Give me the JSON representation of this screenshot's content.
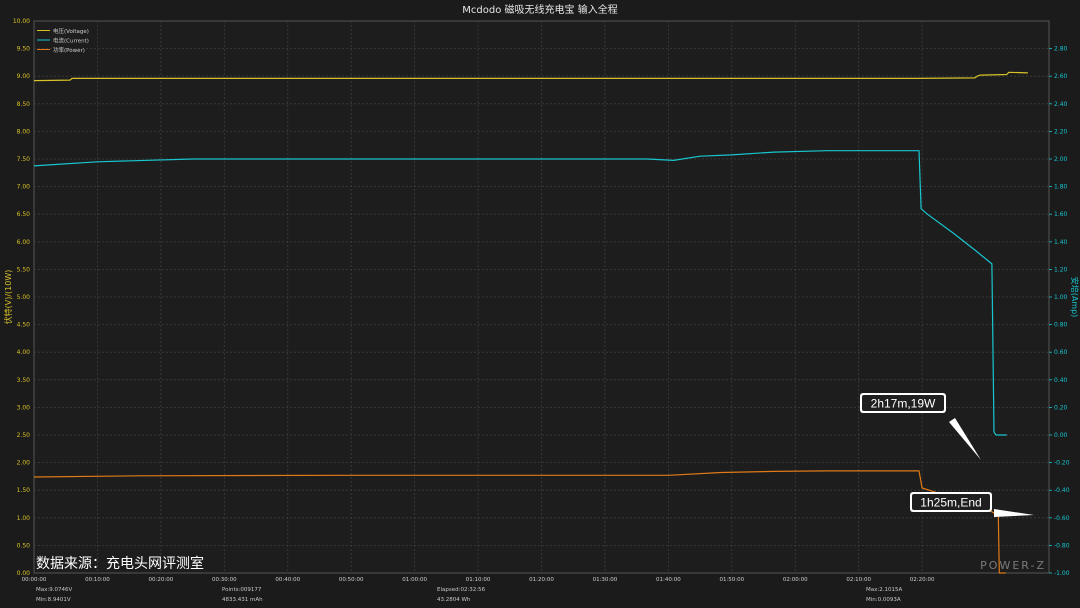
{
  "chart_data": {
    "type": "line",
    "title": "Mcdodo 磁吸无线充电宝 输入全程",
    "ylabel_left": "伏特(V)/(10W)",
    "ylabel_right": "安培(Amp)",
    "ylim_left": [
      0,
      10
    ],
    "ylim_right": [
      -1,
      3
    ],
    "x_unit": "seconds",
    "xlim": [
      0,
      9600
    ],
    "left_ticks": [
      "0.00",
      "0.50",
      "1.00",
      "1.50",
      "2.00",
      "2.50",
      "3.00",
      "3.50",
      "4.00",
      "4.50",
      "5.00",
      "5.50",
      "6.00",
      "6.50",
      "7.00",
      "7.50",
      "8.00",
      "8.50",
      "9.00",
      "9.50",
      "10.00"
    ],
    "right_ticks": [
      "-1.00",
      "-0.80",
      "-0.60",
      "-0.40",
      "-0.20",
      "0.00",
      "0.20",
      "0.40",
      "0.60",
      "0.80",
      "1.00",
      "1.20",
      "1.40",
      "1.60",
      "1.80",
      "2.00",
      "2.20",
      "2.40",
      "2.60",
      "2.80"
    ],
    "x_ticks": [
      "00:00:00",
      "00:10:00",
      "00:20:00",
      "00:30:00",
      "00:40:00",
      "00:50:00",
      "01:00:00",
      "01:10:00",
      "01:20:00",
      "01:30:00",
      "01:40:00",
      "01:50:00",
      "02:00:00",
      "02:10:00",
      "02:20:00"
    ],
    "legend": [
      {
        "name": "电压(Voltage)",
        "color": "#d8c228"
      },
      {
        "name": "电流(Current)",
        "color": "#18c6cf"
      },
      {
        "name": "功率(Power)",
        "color": "#e07a18"
      }
    ],
    "series": [
      {
        "name": "电压(Voltage)",
        "axis": "left",
        "color": "#d8c228",
        "points": [
          [
            0,
            8.92
          ],
          [
            340,
            8.93
          ],
          [
            360,
            8.96
          ],
          [
            8350,
            8.96
          ],
          [
            8900,
            8.97
          ],
          [
            8920,
            9.0
          ],
          [
            8950,
            9.02
          ],
          [
            9200,
            9.03
          ],
          [
            9220,
            9.07
          ],
          [
            9400,
            9.06
          ]
        ]
      },
      {
        "name": "电流(Current)",
        "axis": "right",
        "color": "#18c6cf",
        "points": [
          [
            0,
            1.95
          ],
          [
            200,
            1.96
          ],
          [
            600,
            1.98
          ],
          [
            1500,
            2.0
          ],
          [
            3000,
            2.0
          ],
          [
            5800,
            2.0
          ],
          [
            6050,
            1.99
          ],
          [
            6300,
            2.02
          ],
          [
            6600,
            2.03
          ],
          [
            7000,
            2.05
          ],
          [
            7500,
            2.06
          ],
          [
            8100,
            2.06
          ],
          [
            8370,
            2.06
          ],
          [
            8390,
            1.64
          ],
          [
            8450,
            1.6
          ],
          [
            8700,
            1.46
          ],
          [
            8900,
            1.34
          ],
          [
            9060,
            1.24
          ],
          [
            9080,
            0.02
          ],
          [
            9100,
            0.0
          ],
          [
            9200,
            0.0
          ]
        ]
      },
      {
        "name": "功率(Power)",
        "axis": "left",
        "color": "#e07a18",
        "points": [
          [
            0,
            1.74
          ],
          [
            1000,
            1.76
          ],
          [
            3000,
            1.77
          ],
          [
            6000,
            1.77
          ],
          [
            6500,
            1.82
          ],
          [
            7000,
            1.84
          ],
          [
            7500,
            1.85
          ],
          [
            8100,
            1.85
          ],
          [
            8370,
            1.85
          ],
          [
            8400,
            1.54
          ],
          [
            8500,
            1.48
          ],
          [
            8700,
            1.36
          ],
          [
            8900,
            1.22
          ],
          [
            9050,
            1.12
          ],
          [
            9120,
            1.04
          ],
          [
            9130,
            0.0
          ],
          [
            9190,
            0.0
          ]
        ]
      }
    ],
    "annotations": [
      {
        "text": "2h17m,19W",
        "target_x": 8370,
        "target_y": 1.82
      },
      {
        "text": "1h25m,End",
        "target_x": 9110,
        "target_y": 1.0
      }
    ],
    "grid": true,
    "legend_position": "top-left"
  },
  "watermark": "数据来源：充电头网评测室",
  "brand": "POWER-Z",
  "stats": {
    "max_v": "Max:9.0746V",
    "min_v": "Min:8.9401V",
    "points": "Points:009177",
    "mah": "4833.431 mAh",
    "elapsed": "Elapsed:02:32:56",
    "wh": "43.2804 Wh",
    "max_a": "Max:2.1015A",
    "min_a": "Min:0.0093A"
  }
}
